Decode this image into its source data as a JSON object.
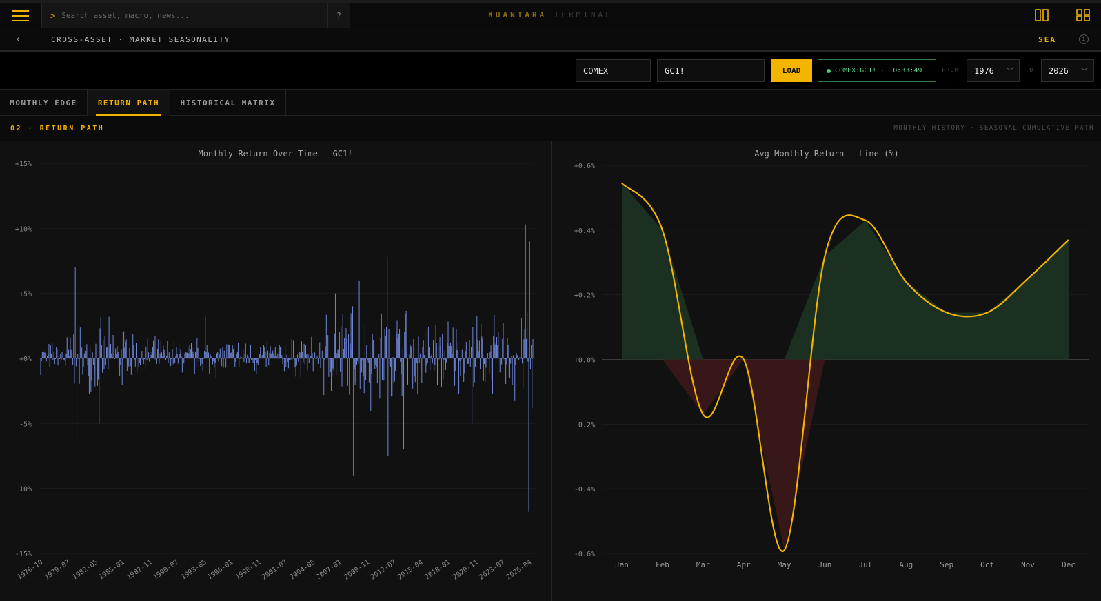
{
  "app": {
    "brand_primary": "KUANTARA",
    "brand_secondary": "TERMINAL",
    "accent": "#f2b300"
  },
  "search": {
    "prompt": ">",
    "placeholder": "Search asset, macro, news...",
    "help_label": "?"
  },
  "icons": {
    "menu": "hamburger-menu-icon",
    "split_layout": "split-layout-icon",
    "grid_layout": "grid-layout-icon",
    "back": "chevron-left-icon",
    "info": "info-icon",
    "select_chevron": "chevron-down-icon"
  },
  "breadcrumb": {
    "back": "‹",
    "path": "CROSS-ASSET · MARKET SEASONALITY",
    "region": "SEA",
    "info": "i"
  },
  "controls": {
    "exchange": "COMEX",
    "symbol": "GC1!",
    "load_label": "LOAD",
    "status": "COMEX:GC1! · 10:33:49",
    "from_label": "FROM",
    "from_value": "1976",
    "to_label": "TO",
    "to_value": "2026"
  },
  "tabs": [
    {
      "label": "MONTHLY EDGE",
      "active": false
    },
    {
      "label": "RETURN PATH",
      "active": true
    },
    {
      "label": "HISTORICAL MATRIX",
      "active": false
    }
  ],
  "section": {
    "title": "02 · RETURN PATH",
    "subtitle": "MONTHLY HISTORY · SEASONAL CUMULATIVE PATH"
  },
  "chart_data": [
    {
      "type": "bar",
      "title": "Monthly Return Over Time — GC1!",
      "ylim": [
        -15,
        15
      ],
      "yticks": [
        "+15%",
        "+10%",
        "+5%",
        "+0%",
        "-5%",
        "-10%",
        "-15%"
      ],
      "x_tick_labels": [
        "1976-10",
        "1979-07",
        "1982-05",
        "1985-01",
        "1987-11",
        "1990-07",
        "1993-05",
        "1996-01",
        "1998-11",
        "2001-07",
        "2004-05",
        "2007-01",
        "2009-11",
        "2012-07",
        "2015-04",
        "2018-01",
        "2020-11",
        "2023-07",
        "2026-04"
      ],
      "bar_color": "#6f86d6",
      "x_start": "1976-07",
      "x_end": "2026-05",
      "highlights": [
        {
          "x": "1980-01",
          "value": 7.0
        },
        {
          "x": "1980-03",
          "value": -6.8
        },
        {
          "x": "1982-06",
          "value": -5.0
        },
        {
          "x": "1993-03",
          "value": 3.2
        },
        {
          "x": "2006-05",
          "value": 5.0
        },
        {
          "x": "2008-03",
          "value": -9.0
        },
        {
          "x": "2008-10",
          "value": 6.0
        },
        {
          "x": "2011-09",
          "value": -7.5
        },
        {
          "x": "2011-08",
          "value": 7.8
        },
        {
          "x": "2013-04",
          "value": -7.0
        },
        {
          "x": "2020-03",
          "value": -5.0
        },
        {
          "x": "2025-08",
          "value": 10.3
        },
        {
          "x": "2025-12",
          "value": -11.8
        },
        {
          "x": "2026-01",
          "value": 9.0
        }
      ]
    },
    {
      "type": "line",
      "title": "Avg Monthly Return — Line (%)",
      "categories": [
        "Jan",
        "Feb",
        "Mar",
        "Apr",
        "May",
        "Jun",
        "Jul",
        "Aug",
        "Sep",
        "Oct",
        "Nov",
        "Dec"
      ],
      "values": [
        0.545,
        0.4,
        -0.17,
        0.0,
        -0.59,
        0.32,
        0.43,
        0.24,
        0.145,
        0.145,
        0.25,
        0.37
      ],
      "ylim": [
        -0.6,
        0.6
      ],
      "yticks": [
        "+0.6%",
        "+0.4%",
        "+0.2%",
        "+0.0%",
        "-0.2%",
        "-0.4%",
        "-0.6%"
      ],
      "line_color": "#f2b300",
      "positive_fill": "#1d3324",
      "negative_fill": "#3a1818"
    }
  ]
}
